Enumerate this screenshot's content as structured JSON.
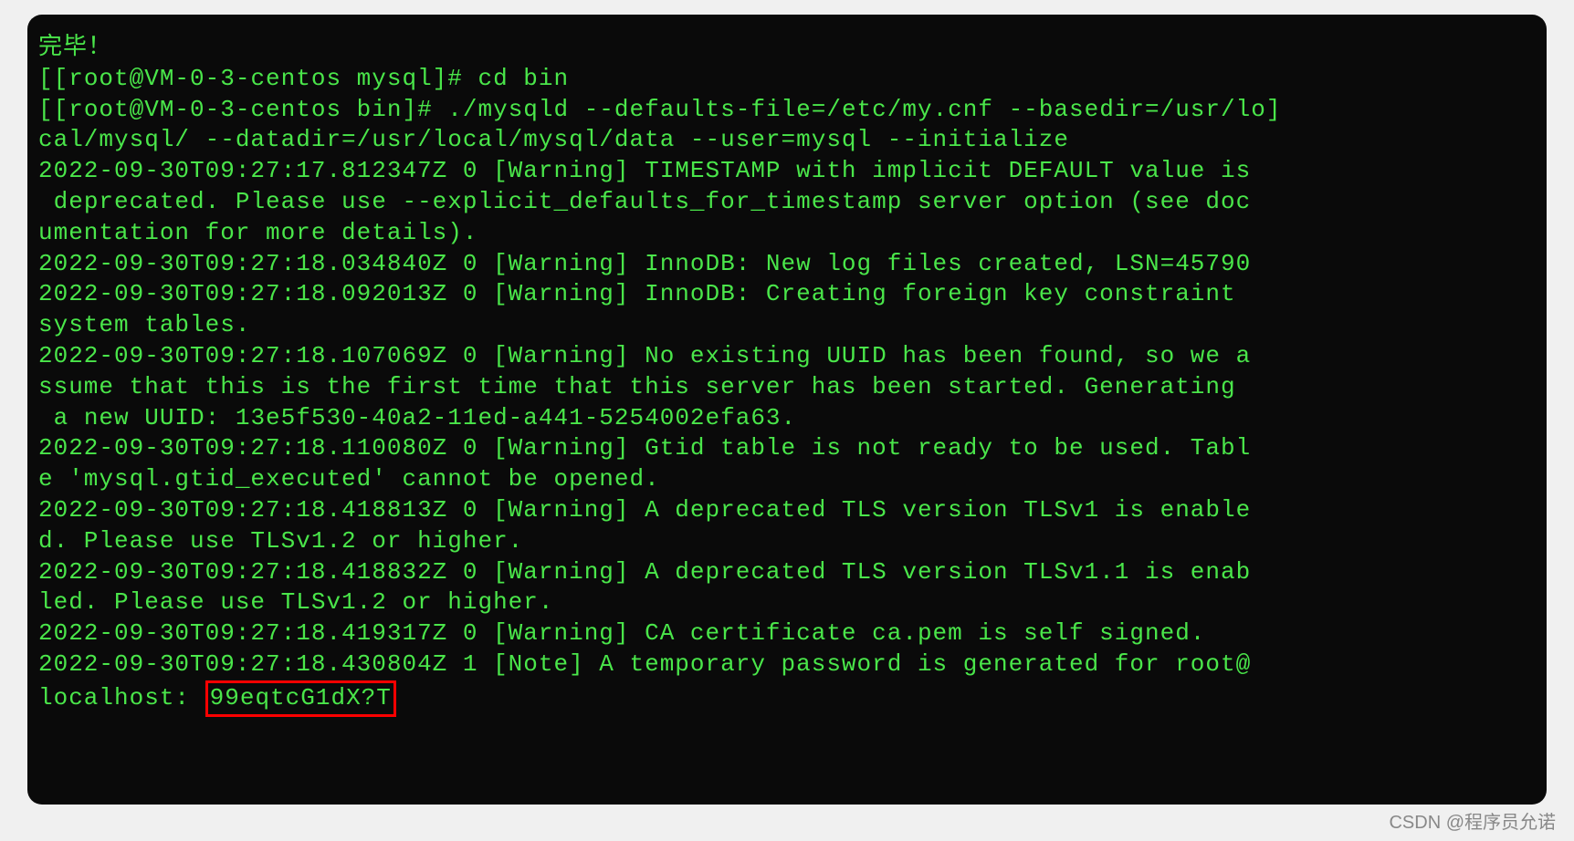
{
  "terminal": {
    "line1": "完毕！",
    "line2_bracket1": "[",
    "line2_prompt": "[root@VM-0-3-centos mysql]# ",
    "line2_cmd": "cd bin",
    "line2_bracket2": "]",
    "line3_bracket1": "[",
    "line3_prompt": "[root@VM-0-3-centos bin]# ",
    "line3_cmd": "./mysqld --defaults-file=/etc/my.cnf --basedir=/usr/lo",
    "line3_bracket2": "]",
    "line4": "cal/mysql/ --datadir=/usr/local/mysql/data --user=mysql --initialize",
    "line5": "2022-09-30T09:27:17.812347Z 0 [Warning] TIMESTAMP with implicit DEFAULT value is",
    "line6": " deprecated. Please use --explicit_defaults_for_timestamp server option (see doc",
    "line7": "umentation for more details).",
    "line8": "2022-09-30T09:27:18.034840Z 0 [Warning] InnoDB: New log files created, LSN=45790",
    "line9": "2022-09-30T09:27:18.092013Z 0 [Warning] InnoDB: Creating foreign key constraint ",
    "line10": "system tables.",
    "line11": "2022-09-30T09:27:18.107069Z 0 [Warning] No existing UUID has been found, so we a",
    "line12": "ssume that this is the first time that this server has been started. Generating",
    "line13": " a new UUID: 13e5f530-40a2-11ed-a441-5254002efa63.",
    "line14": "2022-09-30T09:27:18.110080Z 0 [Warning] Gtid table is not ready to be used. Tabl",
    "line15": "e 'mysql.gtid_executed' cannot be opened.",
    "line16": "2022-09-30T09:27:18.418813Z 0 [Warning] A deprecated TLS version TLSv1 is enable",
    "line17": "d. Please use TLSv1.2 or higher.",
    "line18": "2022-09-30T09:27:18.418832Z 0 [Warning] A deprecated TLS version TLSv1.1 is enab",
    "line19": "led. Please use TLSv1.2 or higher.",
    "line20": "2022-09-30T09:27:18.419317Z 0 [Warning] CA certificate ca.pem is self signed.",
    "line21": "2022-09-30T09:27:18.430804Z 1 [Note] A temporary password is generated for root@",
    "line22_prefix": "localhost: ",
    "line22_password": "99eqtcG1dX?T"
  },
  "watermark": "CSDN @程序员允诺"
}
